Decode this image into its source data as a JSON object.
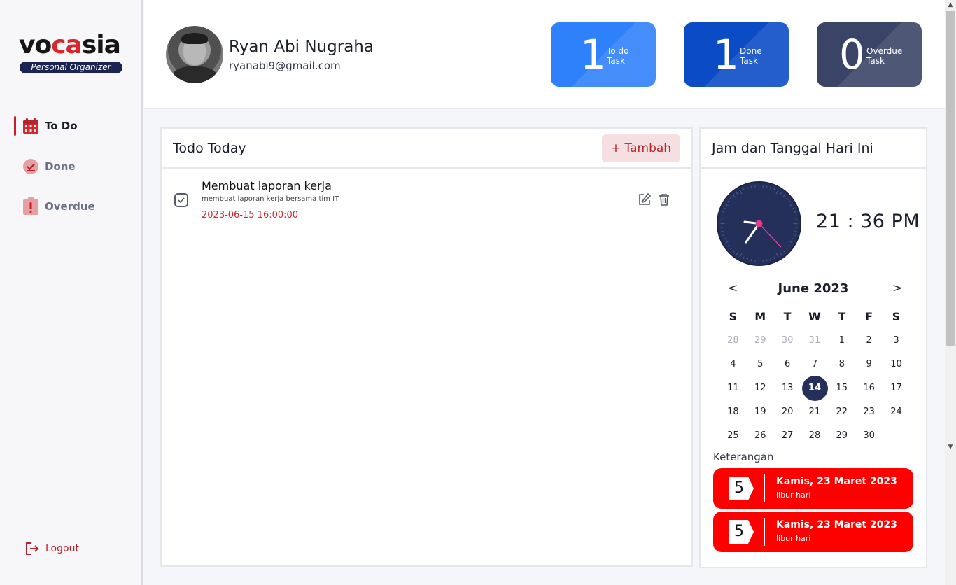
{
  "brand": {
    "name_part1": "vo",
    "name_part2": "ca",
    "name_part3": "sia",
    "tagline": "Personal Organizer"
  },
  "sidebar": {
    "items": [
      {
        "label": "To Do",
        "icon": "calendar-icon",
        "active": true
      },
      {
        "label": "Done",
        "icon": "check-circle-icon",
        "active": false
      },
      {
        "label": "Overdue",
        "icon": "alert-icon",
        "active": false
      }
    ],
    "logout_label": "Logout"
  },
  "user": {
    "name": "Ryan Abi Nugraha",
    "email": "ryanabi9@gmail.com"
  },
  "stats": {
    "todo": {
      "count": "1",
      "line1": "To do",
      "line2": "Task",
      "color": "#2f80fb"
    },
    "done": {
      "count": "1",
      "line1": "Done",
      "line2": "Task",
      "color": "#0b4bc6"
    },
    "overdue": {
      "count": "0",
      "line1": "Overdue",
      "line2": "Task",
      "color": "#3a4466"
    }
  },
  "todo_panel": {
    "title": "Todo Today",
    "add_label": "+ Tambah",
    "tasks": [
      {
        "title": "Membuat laporan kerja",
        "description": "membuat laporan kerja bersama tim IT",
        "due": "2023-06-15 16:00:00"
      }
    ]
  },
  "clock_panel": {
    "title": "Jam dan Tanggal Hari Ini",
    "time": "21 : 36 PM",
    "calendar": {
      "prev": "<",
      "next": ">",
      "month_label": "June 2023",
      "weekdays": [
        "S",
        "M",
        "T",
        "W",
        "T",
        "F",
        "S"
      ],
      "weeks": [
        [
          "28",
          "29",
          "30",
          "31",
          "1",
          "2",
          "3"
        ],
        [
          "4",
          "5",
          "6",
          "7",
          "8",
          "9",
          "10"
        ],
        [
          "11",
          "12",
          "13",
          "14",
          "15",
          "16",
          "17"
        ],
        [
          "18",
          "19",
          "20",
          "21",
          "22",
          "23",
          "24"
        ],
        [
          "25",
          "26",
          "27",
          "28",
          "29",
          "30",
          ""
        ]
      ],
      "muted_first_row": 4,
      "selected_day": "14"
    },
    "legend_title": "Keterangan",
    "holidays": [
      {
        "badge": "5",
        "date": "Kamis, 23 Maret 2023",
        "desc": "libur hari"
      },
      {
        "badge": "5",
        "date": "Kamis, 23 Maret 2023",
        "desc": "libur hari"
      }
    ],
    "accent_color": "#25305a",
    "holiday_color": "#ff0000"
  }
}
